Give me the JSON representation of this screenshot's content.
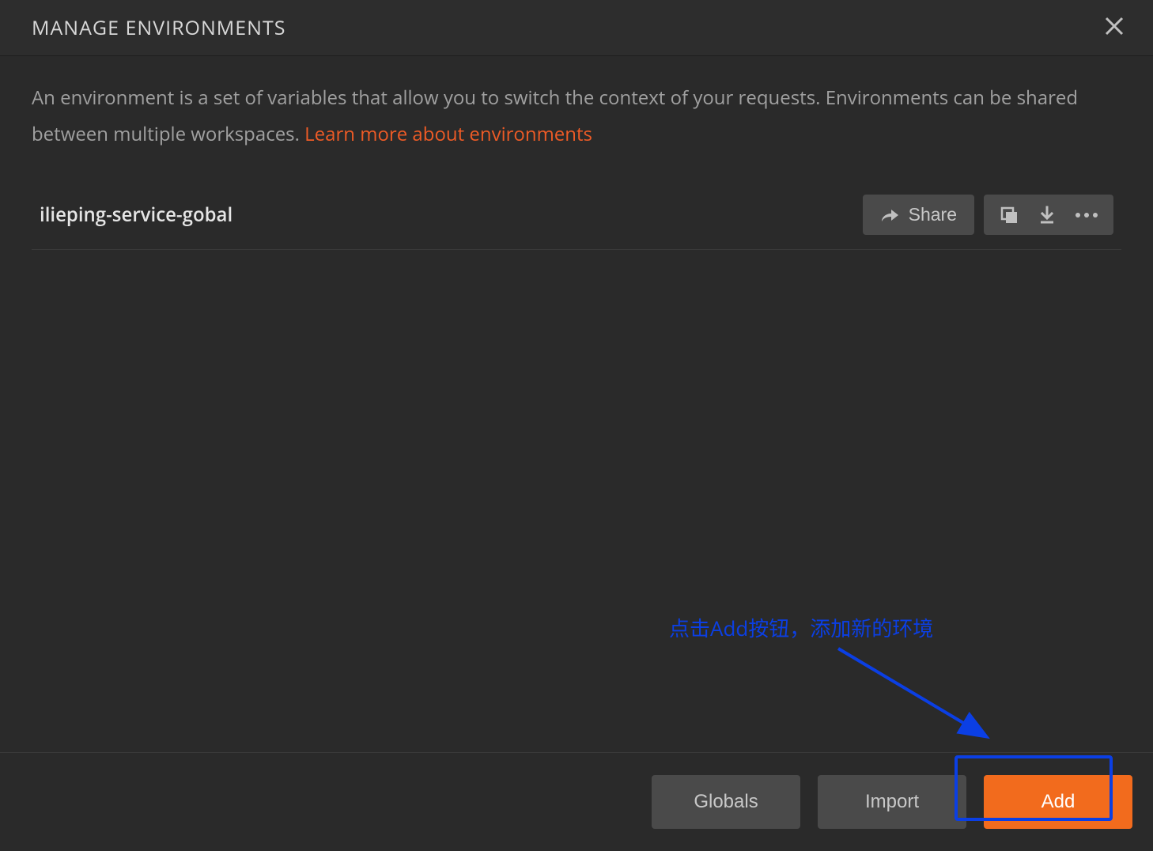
{
  "modal": {
    "title": "MANAGE ENVIRONMENTS",
    "description_prefix": "An environment is a set of variables that allow you to switch the context of your requests. Environments can be shared between multiple workspaces. ",
    "learn_more_label": "Learn more about environments"
  },
  "environments": [
    {
      "name": "ilieping-service-gobal",
      "share_label": "Share"
    }
  ],
  "footer": {
    "globals_label": "Globals",
    "import_label": "Import",
    "add_label": "Add"
  },
  "annotation": {
    "text": "点击Add按钮，添加新的环境"
  },
  "colors": {
    "accent": "#f26b1d",
    "link": "#ed5b26",
    "highlight": "#0b3fe4"
  }
}
